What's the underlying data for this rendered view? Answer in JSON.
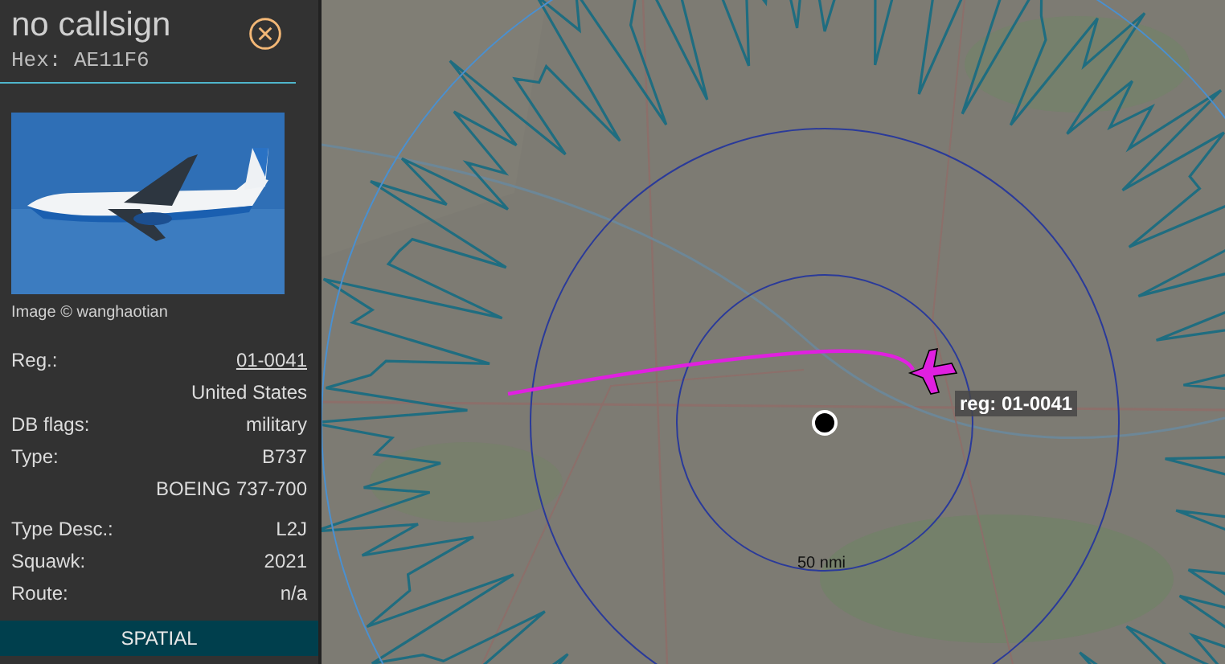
{
  "sidebar": {
    "callsign": "no callsign",
    "hex": "Hex: AE11F6",
    "photo_credit": "Image © wanghaotian",
    "details": [
      {
        "label": "Reg.:",
        "value": "01-0041",
        "kind": "link"
      },
      {
        "value": "United States",
        "kind": "text"
      },
      {
        "label": "DB flags:",
        "value": "military",
        "kind": "text"
      },
      {
        "label": "Type:",
        "value": "B737",
        "kind": "text"
      },
      {
        "value": "BOEING 737-700",
        "kind": "text"
      },
      {
        "label": "Type Desc.:",
        "value": "L2J",
        "kind": "text",
        "group_start": true
      },
      {
        "label": "Squawk:",
        "value": "2021",
        "kind": "text"
      },
      {
        "label": "Route:",
        "value": "n/a",
        "kind": "text"
      }
    ],
    "tab": "SPATIAL"
  },
  "map": {
    "aircraft_label": "reg: 01-0041",
    "range_label": "50 nmi"
  }
}
